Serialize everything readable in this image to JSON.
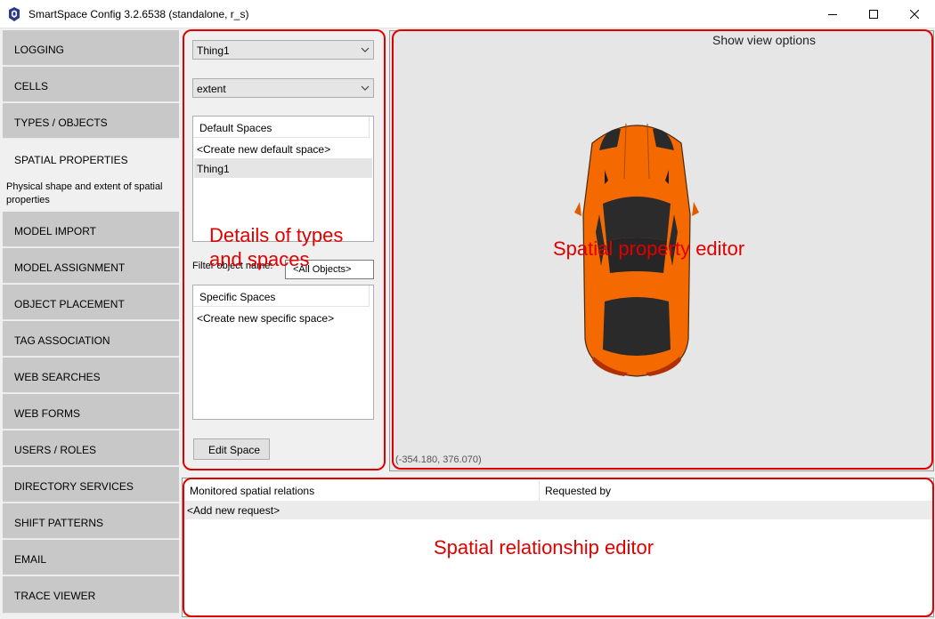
{
  "window": {
    "title": "SmartSpace Config 3.2.6538 (standalone, r_s)",
    "icon": "app-icon"
  },
  "sidebar": {
    "items": [
      {
        "label": "LOGGING"
      },
      {
        "label": "CELLS"
      },
      {
        "label": "TYPES / OBJECTS"
      },
      {
        "label": "SPATIAL PROPERTIES",
        "active": true,
        "description": "Physical shape and extent of spatial properties"
      },
      {
        "label": "MODEL IMPORT"
      },
      {
        "label": "MODEL ASSIGNMENT"
      },
      {
        "label": "OBJECT PLACEMENT"
      },
      {
        "label": "TAG ASSOCIATION"
      },
      {
        "label": "WEB SEARCHES"
      },
      {
        "label": "WEB FORMS"
      },
      {
        "label": "USERS / ROLES"
      },
      {
        "label": "DIRECTORY SERVICES"
      },
      {
        "label": "SHIFT PATTERNS"
      },
      {
        "label": "EMAIL"
      },
      {
        "label": "TRACE VIEWER"
      }
    ]
  },
  "details": {
    "type_select": "Thing1",
    "property_select": "extent",
    "default_spaces": {
      "header": "Default Spaces",
      "rows": [
        "<Create new default space>",
        "Thing1"
      ]
    },
    "filter_label": "Filter object name:",
    "filter_value": "<All Objects>",
    "specific_spaces": {
      "header": "Specific Spaces",
      "rows": [
        "<Create new specific space>"
      ]
    },
    "edit_button": "Edit Space"
  },
  "canvas": {
    "view_options": "Show view options",
    "coords": "(-354.180, 376.070)",
    "car_color": "#f46a00"
  },
  "relations": {
    "columns": [
      "Monitored spatial relations",
      "Requested by"
    ],
    "rows": [
      "<Add new request>"
    ]
  },
  "annotations": {
    "details": "Details of types and spaces",
    "editor": "Spatial property editor",
    "relationship": "Spatial relationship editor",
    "color": "#e00000"
  }
}
